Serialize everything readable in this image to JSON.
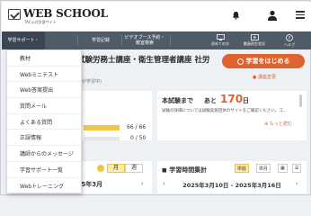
{
  "header": {
    "logo_text": "WEB SCHOOL",
    "logo_sub": "TAC公式学習サイト"
  },
  "nav": {
    "items": [
      {
        "label": "学習サポート・"
      },
      {
        "label": "学習記録"
      },
      {
        "label": "ビデオブース予約・\n教室検索"
      }
    ],
    "right": [
      {
        "label": "初めての方",
        "icon": "monitor-icon"
      },
      {
        "label": "動画再生状況",
        "icon": "video-icon"
      },
      {
        "label": "ヘルプ",
        "icon": "help-icon"
      }
    ]
  },
  "dropdown": {
    "items": [
      "教材",
      "Webミニテスト",
      "Web答案提出",
      "質問メール",
      "よくある質問",
      "正誤情報",
      "講師からのメッセージ",
      "学習サポート一覧",
      "Webトレーニング"
    ]
  },
  "main": {
    "course_title": "試験労務士講座・衛生管理者講座 社労",
    "cta_label": "学習をはじめる",
    "edit_link": "講座変更",
    "partial_note": "入が学習中)",
    "progress": {
      "rows": [
        {
          "value_text": "66 / 66",
          "fraction": 1.0
        },
        {
          "value_text": "0 / 50",
          "fraction": 0.0
        }
      ]
    },
    "exam": {
      "label": "本試験まで",
      "ato": "あと",
      "days": "170",
      "unit": "日",
      "note": "試験の詳細については試験実施団体のサイトをご確認ください。コ...",
      "more": "もっと読む"
    },
    "calendar": {
      "toggle_month": "月",
      "toggle_week": "週",
      "month": "2025年3月",
      "prev": "‹",
      "next": "›"
    },
    "stats": {
      "title": "学習時間集計",
      "btn_week": "週",
      "btn_month": "月",
      "range": "2025年3月10日 - 2025年3月16日",
      "prev": "‹",
      "next": "›"
    }
  },
  "colors": {
    "accent": "#e0622f",
    "nav_bg": "#4f5b67",
    "highlight": "#f0c64a"
  }
}
